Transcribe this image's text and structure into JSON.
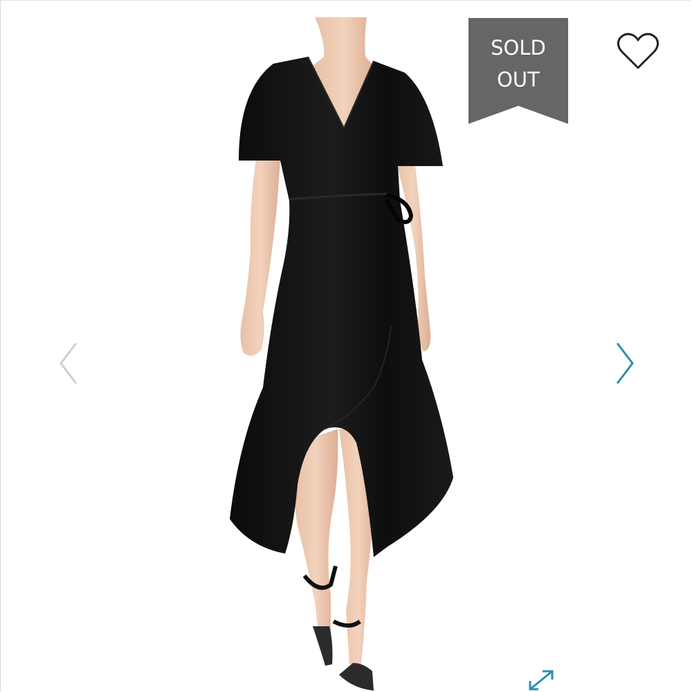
{
  "listing": {
    "status_line1": "SOLD",
    "status_line2": "OUT",
    "badge_color": "#666666",
    "accent_color": "#2a8fb0"
  },
  "icons": {
    "favorite": "heart-icon",
    "previous": "chevron-left-icon",
    "next": "chevron-right-icon",
    "zoom": "expand-icon"
  }
}
